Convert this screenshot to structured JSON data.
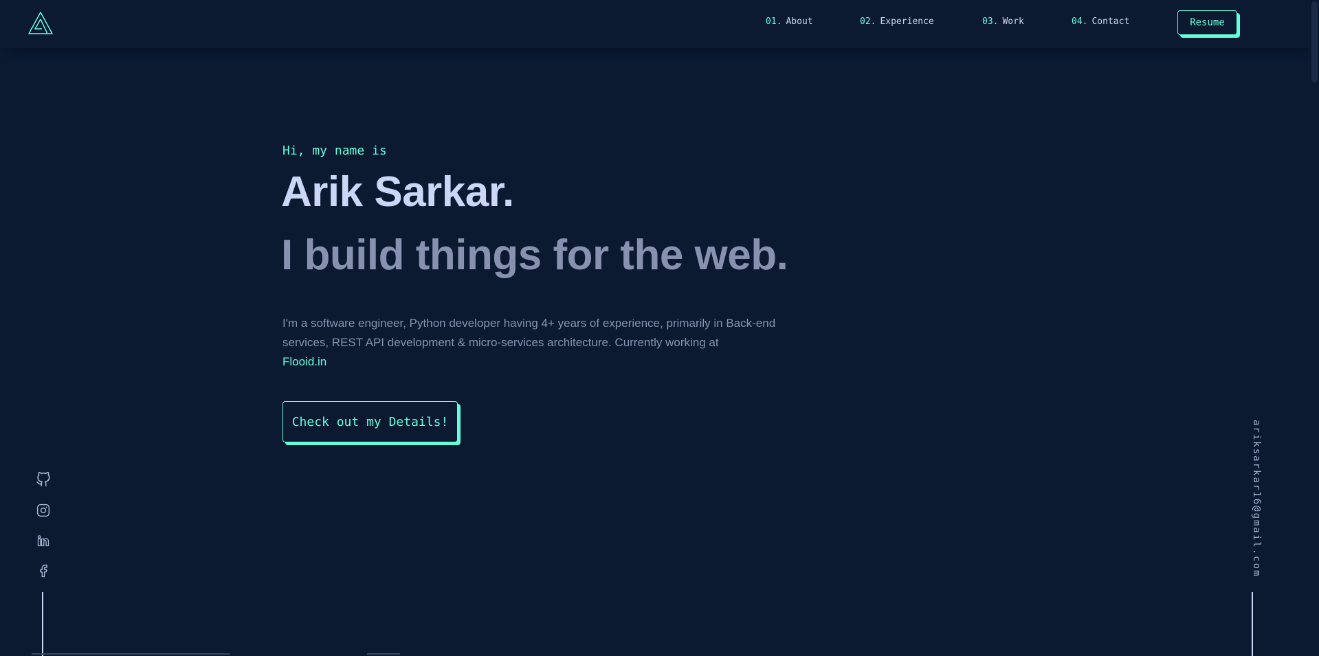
{
  "header": {
    "logo_icon": "logo-a-triangle-icon",
    "nav": [
      {
        "num": "01.",
        "label": "About"
      },
      {
        "num": "02.",
        "label": "Experience"
      },
      {
        "num": "03.",
        "label": "Work"
      },
      {
        "num": "04.",
        "label": "Contact"
      }
    ],
    "resume_label": "Resume"
  },
  "hero": {
    "greeting": "Hi, my name is",
    "name": "Arik Sarkar.",
    "tagline": "I build things for the web.",
    "description": "I'm a software engineer, Python developer having 4+ years of experience, primarily in Back-end services, REST API development & micro-services architecture. Currently working at",
    "company_link": "Flooid.in",
    "cta_label": "Check out my Details!"
  },
  "socials": [
    {
      "icon": "github-icon"
    },
    {
      "icon": "instagram-icon"
    },
    {
      "icon": "linkedin-icon"
    },
    {
      "icon": "facebook-icon"
    }
  ],
  "email": "ariksarkar16@gmail.com",
  "colors": {
    "background": "#0b1931",
    "accent": "#64ffda",
    "heading": "#ccd6f6",
    "muted": "#8892b0"
  }
}
